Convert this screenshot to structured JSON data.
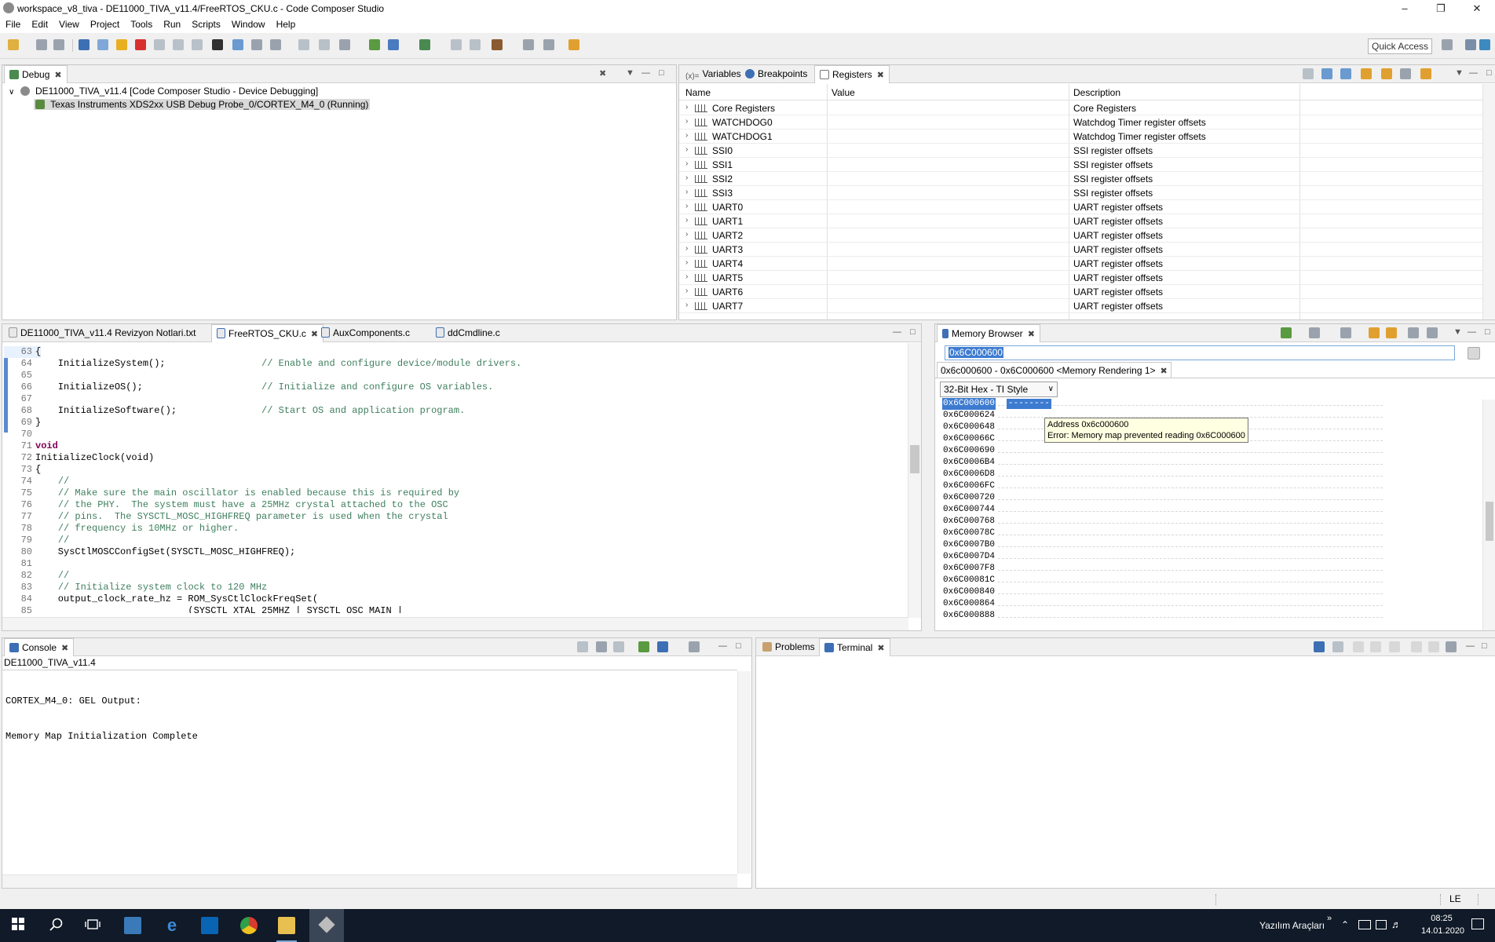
{
  "window": {
    "title": "workspace_v8_tiva - DE11000_TIVA_v11.4/FreeRTOS_CKU.c - Code Composer Studio"
  },
  "menu": [
    "File",
    "Edit",
    "View",
    "Project",
    "Tools",
    "Run",
    "Scripts",
    "Window",
    "Help"
  ],
  "toolbar": {
    "quick_access": "Quick Access"
  },
  "debug": {
    "tab": "Debug",
    "tree": [
      {
        "label": "DE11000_TIVA_v11.4 [Code Composer Studio - Device Debugging]"
      },
      {
        "label": "Texas Instruments XDS2xx USB Debug Probe_0/CORTEX_M4_0 (Running)"
      }
    ]
  },
  "registers": {
    "tabs": [
      "Variables",
      "Breakpoints",
      "Registers"
    ],
    "columns": [
      "Name",
      "Value",
      "Description"
    ],
    "rows": [
      {
        "name": "Core Registers",
        "value": "",
        "desc": "Core Registers"
      },
      {
        "name": "WATCHDOG0",
        "value": "",
        "desc": "Watchdog Timer register offsets"
      },
      {
        "name": "WATCHDOG1",
        "value": "",
        "desc": "Watchdog Timer register offsets"
      },
      {
        "name": "SSI0",
        "value": "",
        "desc": "SSI register offsets"
      },
      {
        "name": "SSI1",
        "value": "",
        "desc": "SSI register offsets"
      },
      {
        "name": "SSI2",
        "value": "",
        "desc": "SSI register offsets"
      },
      {
        "name": "SSI3",
        "value": "",
        "desc": "SSI register offsets"
      },
      {
        "name": "UART0",
        "value": "",
        "desc": "UART register offsets"
      },
      {
        "name": "UART1",
        "value": "",
        "desc": "UART register offsets"
      },
      {
        "name": "UART2",
        "value": "",
        "desc": "UART register offsets"
      },
      {
        "name": "UART3",
        "value": "",
        "desc": "UART register offsets"
      },
      {
        "name": "UART4",
        "value": "",
        "desc": "UART register offsets"
      },
      {
        "name": "UART5",
        "value": "",
        "desc": "UART register offsets"
      },
      {
        "name": "UART6",
        "value": "",
        "desc": "UART register offsets"
      },
      {
        "name": "UART7",
        "value": "",
        "desc": "UART register offsets"
      }
    ]
  },
  "editor": {
    "tabs": [
      "DE11000_TIVA_v11.4 Revizyon Notlari.txt",
      "FreeRTOS_CKU.c",
      "AuxComponents.c",
      "ddCmdline.c"
    ],
    "active_tab": "FreeRTOS_CKU.c",
    "lines": [
      {
        "n": "63",
        "code": "{",
        "comment": ""
      },
      {
        "n": "64",
        "code": "    InitializeSystem();                 ",
        "comment": "// Enable and configure device/module drivers."
      },
      {
        "n": "65",
        "code": "",
        "comment": ""
      },
      {
        "n": "66",
        "code": "    InitializeOS();                     ",
        "comment": "// Initialize and configure OS variables."
      },
      {
        "n": "67",
        "code": "",
        "comment": ""
      },
      {
        "n": "68",
        "code": "    InitializeSoftware();               ",
        "comment": "// Start OS and application program."
      },
      {
        "n": "69",
        "code": "}",
        "comment": ""
      },
      {
        "n": "70",
        "code": "",
        "comment": ""
      },
      {
        "n": "71",
        "code": "void",
        "comment": ""
      },
      {
        "n": "72",
        "code": "InitializeClock(void)",
        "comment": ""
      },
      {
        "n": "73",
        "code": "{",
        "comment": ""
      },
      {
        "n": "74",
        "code": "    ",
        "comment": "//"
      },
      {
        "n": "75",
        "code": "    ",
        "comment": "// Make sure the main oscillator is enabled because this is required by"
      },
      {
        "n": "76",
        "code": "    ",
        "comment": "// the PHY.  The system must have a 25MHz crystal attached to the OSC"
      },
      {
        "n": "77",
        "code": "    ",
        "comment": "// pins.  The SYSCTL_MOSC_HIGHFREQ parameter is used when the crystal"
      },
      {
        "n": "78",
        "code": "    ",
        "comment": "// frequency is 10MHz or higher."
      },
      {
        "n": "79",
        "code": "    ",
        "comment": "//"
      },
      {
        "n": "80",
        "code": "    SysCtlMOSCConfigSet(SYSCTL_MOSC_HIGHFREQ);",
        "comment": ""
      },
      {
        "n": "81",
        "code": "",
        "comment": ""
      },
      {
        "n": "82",
        "code": "    ",
        "comment": "//"
      },
      {
        "n": "83",
        "code": "    ",
        "comment": "// Initialize system clock to 120 MHz"
      },
      {
        "n": "84",
        "code": "    output_clock_rate_hz = ROM_SysCtlClockFreqSet(",
        "comment": ""
      },
      {
        "n": "85",
        "code": "                           (SYSCTL_XTAL_25MHZ | SYSCTL_OSC_MAIN |",
        "comment": ""
      }
    ]
  },
  "memory": {
    "tab": "Memory Browser",
    "address_input": "0x6C000600",
    "rendering_tab": "0x6c000600 - 0x6C000600 <Memory Rendering 1>",
    "format": "32-Bit Hex - TI Style",
    "selected_value": "--------",
    "tooltip": {
      "line1": "Address 0x6c000600",
      "line2": "Error: Memory map prevented reading 0x6C000600"
    },
    "addresses": [
      "0x6C000600",
      "0x6C000624",
      "0x6C000648",
      "0x6C00066C",
      "0x6C000690",
      "0x6C0006B4",
      "0x6C0006D8",
      "0x6C0006FC",
      "0x6C000720",
      "0x6C000744",
      "0x6C000768",
      "0x6C00078C",
      "0x6C0007B0",
      "0x6C0007D4",
      "0x6C0007F8",
      "0x6C00081C",
      "0x6C000840",
      "0x6C000864",
      "0x6C000888"
    ]
  },
  "console": {
    "tab": "Console",
    "project": "DE11000_TIVA_v11.4",
    "lines": [
      "CORTEX_M4_0: GEL Output:",
      "Memory Map Initialization Complete"
    ]
  },
  "bottom_right": {
    "tabs": [
      "Problems",
      "Terminal"
    ]
  },
  "statusbar": {
    "mode": "LE"
  },
  "taskbar": {
    "tray_label": "Yazılım Araçları",
    "time": "08:25",
    "date": "14.01.2020"
  }
}
